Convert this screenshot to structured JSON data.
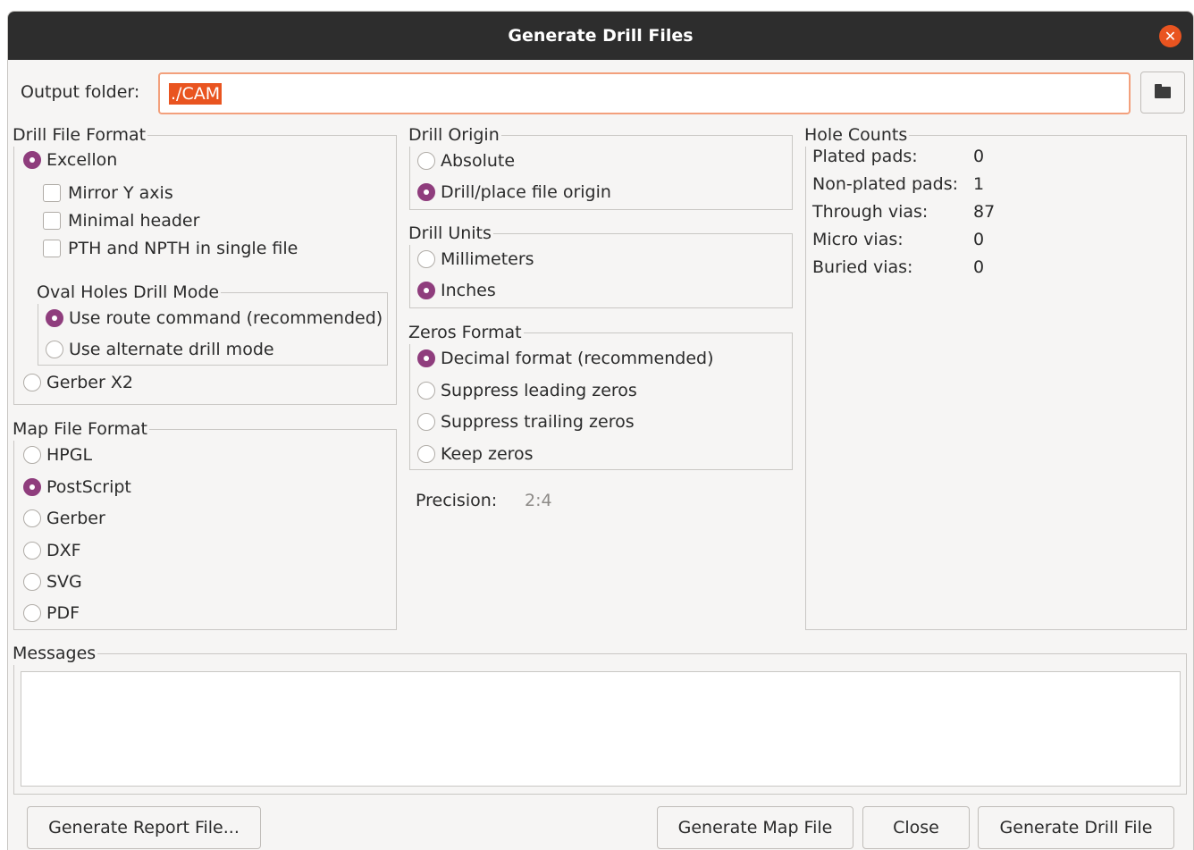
{
  "window": {
    "title": "Generate Drill Files"
  },
  "output": {
    "label": "Output folder:",
    "value": "./CAM"
  },
  "drill_file_format": {
    "legend": "Drill File Format",
    "excellon": "Excellon",
    "mirror_y": "Mirror Y axis",
    "minimal_header": "Minimal header",
    "pth_npth": "PTH and NPTH in single file",
    "oval_legend": "Oval Holes Drill Mode",
    "route_cmd": "Use route command (recommended)",
    "alt_drill": "Use alternate drill mode",
    "gerber_x2": "Gerber X2",
    "selected": "Excellon",
    "oval_selected": "Use route command (recommended)"
  },
  "map_file_format": {
    "legend": "Map File Format",
    "options": [
      "HPGL",
      "PostScript",
      "Gerber",
      "DXF",
      "SVG",
      "PDF"
    ],
    "selected": "PostScript"
  },
  "drill_origin": {
    "legend": "Drill Origin",
    "options": [
      "Absolute",
      "Drill/place file origin"
    ],
    "selected": "Drill/place file origin"
  },
  "drill_units": {
    "legend": "Drill Units",
    "options": [
      "Millimeters",
      "Inches"
    ],
    "selected": "Inches"
  },
  "zeros_format": {
    "legend": "Zeros Format",
    "options": [
      "Decimal format (recommended)",
      "Suppress leading zeros",
      "Suppress trailing zeros",
      "Keep zeros"
    ],
    "selected": "Decimal format (recommended)"
  },
  "precision": {
    "label": "Precision:",
    "value": "2:4"
  },
  "hole_counts": {
    "legend": "Hole Counts",
    "rows": [
      {
        "label": "Plated pads:",
        "value": "0"
      },
      {
        "label": "Non-plated pads:",
        "value": "1"
      },
      {
        "label": "Through vias:",
        "value": "87"
      },
      {
        "label": "Micro vias:",
        "value": "0"
      },
      {
        "label": "Buried vias:",
        "value": "0"
      }
    ]
  },
  "messages": {
    "legend": "Messages"
  },
  "buttons": {
    "report": "Generate Report File...",
    "map": "Generate Map File",
    "close": "Close",
    "drill": "Generate Drill File"
  },
  "colors": {
    "accent": "#8f3d7d",
    "selection": "#e95420",
    "titlebar": "#2d2d2d"
  }
}
